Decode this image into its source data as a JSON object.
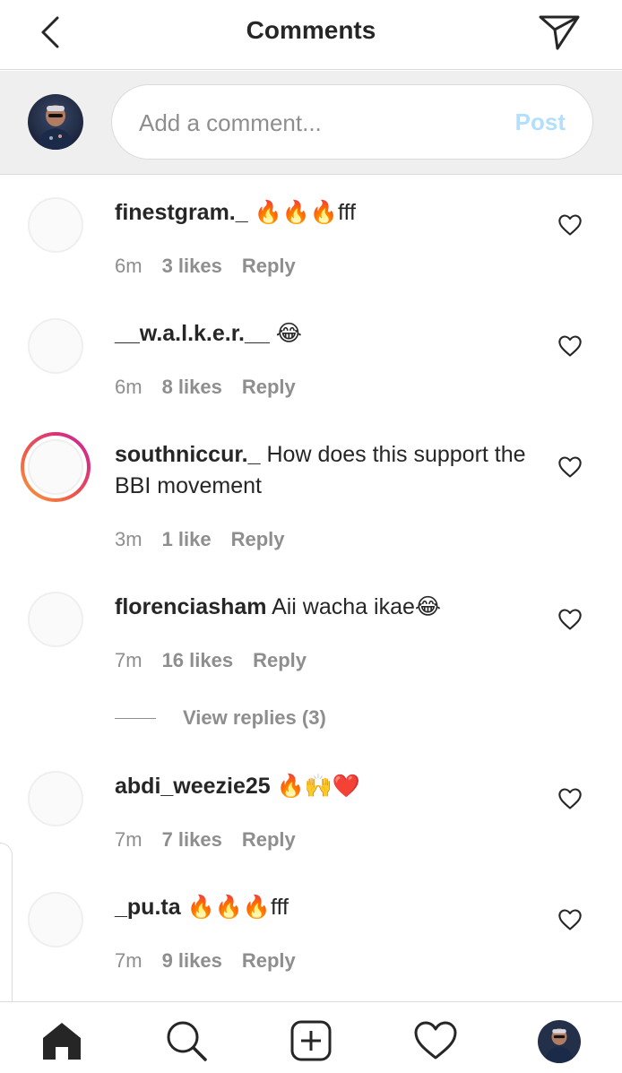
{
  "header": {
    "title": "Comments"
  },
  "composer": {
    "placeholder": "Add a comment...",
    "post_label": "Post"
  },
  "comments": [
    {
      "user": "finestgram._",
      "text": " 🔥🔥🔥fff",
      "time": "6m",
      "likes": "3 likes",
      "reply": "Reply",
      "story_ring": false
    },
    {
      "user": "__w.a.l.k.e.r.__",
      "text": " 😂",
      "time": "6m",
      "likes": "8 likes",
      "reply": "Reply",
      "story_ring": false
    },
    {
      "user": "southniccur._",
      "text": " How does this support the BBI movement",
      "time": "3m",
      "likes": "1 like",
      "reply": "Reply",
      "story_ring": true
    },
    {
      "user": "florenciasham",
      "text": " Aii wacha ikae😂",
      "time": "7m",
      "likes": "16 likes",
      "reply": "Reply",
      "story_ring": false
    },
    {
      "user": "abdi_weezie25",
      "text": " 🔥🙌❤️",
      "time": "7m",
      "likes": "7 likes",
      "reply": "Reply",
      "story_ring": false
    },
    {
      "user": "_pu.ta",
      "text": " 🔥🔥🔥fff",
      "time": "7m",
      "likes": "9 likes",
      "reply": "Reply",
      "story_ring": false
    }
  ],
  "view_replies": "View replies (3)",
  "colors": {
    "text": "#262626",
    "secondary": "#8e8e8e",
    "post_disabled": "#b2dffc",
    "composer_bg": "#efefef"
  },
  "icons": {
    "header": [
      "back-arrow-icon",
      "direct-send-icon"
    ],
    "comment": "heart-outline-icon",
    "nav": [
      "home-icon",
      "search-icon",
      "add-post-icon",
      "activity-heart-icon",
      "profile-avatar"
    ]
  }
}
